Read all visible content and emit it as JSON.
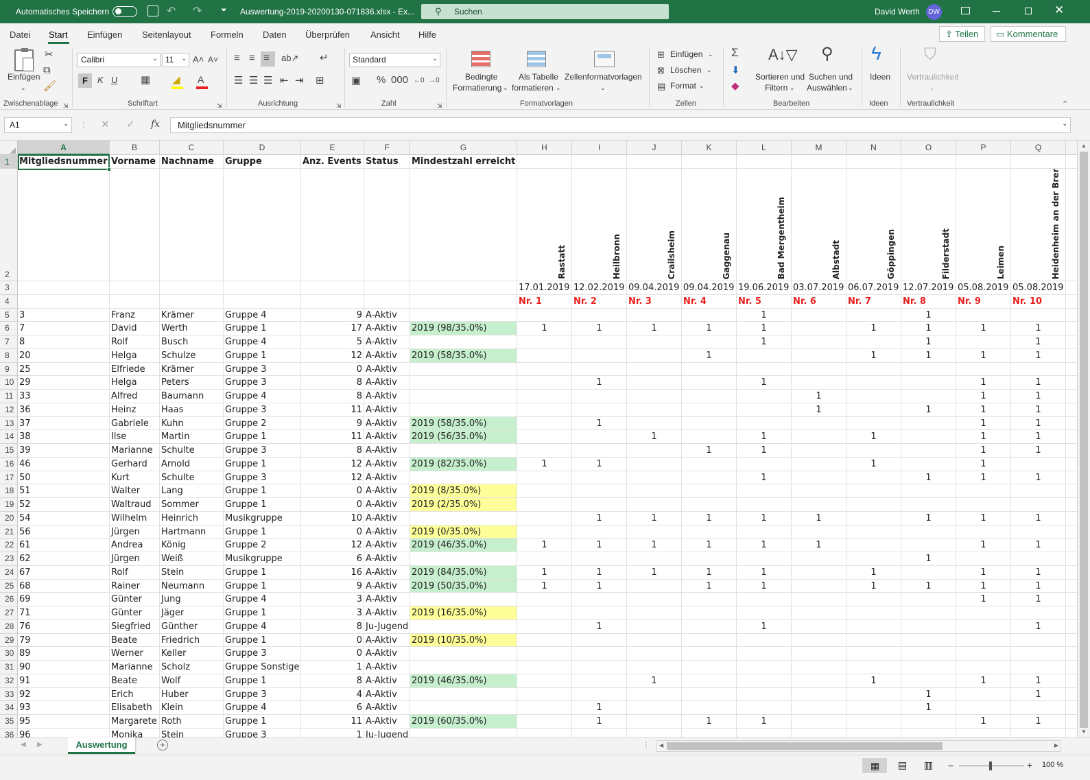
{
  "titlebar": {
    "autosave_label": "Automatisches Speichern",
    "filename": "Auswertung-2019-20200130-071836.xlsx - Ex...",
    "search_placeholder": "Suchen",
    "user_name": "David Werth",
    "user_initials": "DW"
  },
  "tabs": [
    "Datei",
    "Start",
    "Einfügen",
    "Seitenlayout",
    "Formeln",
    "Daten",
    "Überprüfen",
    "Ansicht",
    "Hilfe"
  ],
  "active_tab": "Start",
  "share_label": "Teilen",
  "comments_label": "Kommentare",
  "ribbon": {
    "paste": "Einfügen",
    "font_name": "Calibri",
    "font_size": "11",
    "bold": "F",
    "italic": "K",
    "underline": "U",
    "number_format": "Standard",
    "cond_format_1": "Bedingte",
    "cond_format_2": "Formatierung",
    "as_table_1": "Als Tabelle",
    "as_table_2": "formatieren",
    "cell_styles": "Zellenformatvorlagen",
    "cells_insert": "Einfügen",
    "cells_delete": "Löschen",
    "cells_format": "Format",
    "sort_1": "Sortieren und",
    "sort_2": "Filtern",
    "find_1": "Suchen und",
    "find_2": "Auswählen",
    "ideas": "Ideen",
    "sensitivity": "Vertraulichkeit",
    "groups": {
      "clipboard": "Zwischenablage",
      "font": "Schriftart",
      "alignment": "Ausrichtung",
      "number": "Zahl",
      "styles": "Formatvorlagen",
      "cells": "Zellen",
      "editing": "Bearbeiten",
      "ideas": "Ideen",
      "sensitivity": "Vertraulichkeit"
    }
  },
  "formula_bar": {
    "name_box": "A1",
    "fx": "fx",
    "content": "Mitgliedsnummer"
  },
  "columns": [
    "A",
    "B",
    "C",
    "D",
    "E",
    "F",
    "G",
    "H",
    "I",
    "J",
    "K",
    "L",
    "M",
    "N",
    "O",
    "P",
    "Q"
  ],
  "header_row": [
    "Mitgliedsnummer",
    "Vorname",
    "Nachname",
    "Gruppe",
    "Anz. Events",
    "Status",
    "Mindestzahl erreicht"
  ],
  "event_places": [
    "Rastatt",
    "Heilbronn",
    "Crailsheim",
    "Gaggenau",
    "Bad Mergentheim",
    "Albstadt",
    "Göppingen",
    "Filderstadt",
    "Leimen",
    "Heidenheim an der Brenz"
  ],
  "event_dates": [
    "17.01.2019",
    "12.02.2019",
    "09.04.2019",
    "09.04.2019",
    "19.06.2019",
    "03.07.2019",
    "06.07.2019",
    "12.07.2019",
    "05.08.2019",
    "05.08.2019"
  ],
  "event_numbers": [
    "Nr. 1",
    "Nr. 2",
    "Nr. 3",
    "Nr. 4",
    "Nr. 5",
    "Nr. 6",
    "Nr. 7",
    "Nr. 8",
    "Nr. 9",
    "Nr. 10"
  ],
  "members": [
    {
      "row": "5",
      "nr": "3",
      "first": "Franz",
      "last": "Krämer",
      "group": "Gruppe 4",
      "events": "9",
      "status": "A-Aktiv",
      "min": "",
      "hl": "",
      "e": [
        "",
        "",
        "",
        "",
        "1",
        "",
        "",
        "1",
        "",
        ""
      ]
    },
    {
      "row": "6",
      "nr": "7",
      "first": "David",
      "last": "Werth",
      "group": "Gruppe 1",
      "events": "17",
      "status": "A-Aktiv",
      "min": "2019 (98/35.0%)",
      "hl": "green",
      "e": [
        "1",
        "1",
        "1",
        "1",
        "1",
        "",
        "1",
        "1",
        "1",
        "1"
      ]
    },
    {
      "row": "7",
      "nr": "8",
      "first": "Rolf",
      "last": "Busch",
      "group": "Gruppe 4",
      "events": "5",
      "status": "A-Aktiv",
      "min": "",
      "hl": "",
      "e": [
        "",
        "",
        "",
        "",
        "1",
        "",
        "",
        "1",
        "",
        "1"
      ]
    },
    {
      "row": "8",
      "nr": "20",
      "first": "Helga",
      "last": "Schulze",
      "group": "Gruppe 1",
      "events": "12",
      "status": "A-Aktiv",
      "min": "2019 (58/35.0%)",
      "hl": "green",
      "e": [
        "",
        "",
        "",
        "1",
        "",
        "",
        "1",
        "1",
        "1",
        "1"
      ]
    },
    {
      "row": "9",
      "nr": "25",
      "first": "Elfriede",
      "last": "Krämer",
      "group": "Gruppe 3",
      "events": "0",
      "status": "A-Aktiv",
      "min": "",
      "hl": "",
      "e": [
        "",
        "",
        "",
        "",
        "",
        "",
        "",
        "",
        "",
        ""
      ]
    },
    {
      "row": "10",
      "nr": "29",
      "first": "Helga",
      "last": "Peters",
      "group": "Gruppe 3",
      "events": "8",
      "status": "A-Aktiv",
      "min": "",
      "hl": "",
      "e": [
        "",
        "1",
        "",
        "",
        "1",
        "",
        "",
        "",
        "1",
        "1"
      ]
    },
    {
      "row": "11",
      "nr": "33",
      "first": "Alfred",
      "last": "Baumann",
      "group": "Gruppe 4",
      "events": "8",
      "status": "A-Aktiv",
      "min": "",
      "hl": "",
      "e": [
        "",
        "",
        "",
        "",
        "",
        "1",
        "",
        "",
        "1",
        "1"
      ]
    },
    {
      "row": "12",
      "nr": "36",
      "first": "Heinz",
      "last": "Haas",
      "group": "Gruppe 3",
      "events": "11",
      "status": "A-Aktiv",
      "min": "",
      "hl": "",
      "e": [
        "",
        "",
        "",
        "",
        "",
        "1",
        "",
        "1",
        "1",
        "1"
      ]
    },
    {
      "row": "13",
      "nr": "37",
      "first": "Gabriele",
      "last": "Kuhn",
      "group": "Gruppe 2",
      "events": "9",
      "status": "A-Aktiv",
      "min": "2019 (58/35.0%)",
      "hl": "green",
      "e": [
        "",
        "1",
        "",
        "",
        "",
        "",
        "",
        "",
        "1",
        "1"
      ]
    },
    {
      "row": "14",
      "nr": "38",
      "first": "Ilse",
      "last": "Martin",
      "group": "Gruppe 1",
      "events": "11",
      "status": "A-Aktiv",
      "min": "2019 (56/35.0%)",
      "hl": "green",
      "e": [
        "",
        "",
        "1",
        "",
        "1",
        "",
        "1",
        "",
        "1",
        "1"
      ]
    },
    {
      "row": "15",
      "nr": "39",
      "first": "Marianne",
      "last": "Schulte",
      "group": "Gruppe 3",
      "events": "8",
      "status": "A-Aktiv",
      "min": "",
      "hl": "",
      "e": [
        "",
        "",
        "",
        "1",
        "1",
        "",
        "",
        "",
        "1",
        "1"
      ]
    },
    {
      "row": "16",
      "nr": "46",
      "first": "Gerhard",
      "last": "Arnold",
      "group": "Gruppe 1",
      "events": "12",
      "status": "A-Aktiv",
      "min": "2019 (82/35.0%)",
      "hl": "green",
      "e": [
        "1",
        "1",
        "",
        "",
        "",
        "",
        "1",
        "",
        "1",
        ""
      ]
    },
    {
      "row": "17",
      "nr": "50",
      "first": "Kurt",
      "last": "Schulte",
      "group": "Gruppe 3",
      "events": "12",
      "status": "A-Aktiv",
      "min": "",
      "hl": "",
      "e": [
        "",
        "",
        "",
        "",
        "1",
        "",
        "",
        "1",
        "1",
        "1"
      ]
    },
    {
      "row": "18",
      "nr": "51",
      "first": "Walter",
      "last": "Lang",
      "group": "Gruppe 1",
      "events": "0",
      "status": "A-Aktiv",
      "min": "2019 (8/35.0%)",
      "hl": "yellow",
      "e": [
        "",
        "",
        "",
        "",
        "",
        "",
        "",
        "",
        "",
        ""
      ]
    },
    {
      "row": "19",
      "nr": "52",
      "first": "Waltraud",
      "last": "Sommer",
      "group": "Gruppe 1",
      "events": "0",
      "status": "A-Aktiv",
      "min": "2019 (2/35.0%)",
      "hl": "yellow",
      "e": [
        "",
        "",
        "",
        "",
        "",
        "",
        "",
        "",
        "",
        ""
      ]
    },
    {
      "row": "20",
      "nr": "54",
      "first": "Wilhelm",
      "last": "Heinrich",
      "group": "Musikgruppe",
      "events": "10",
      "status": "A-Aktiv",
      "min": "",
      "hl": "",
      "e": [
        "",
        "1",
        "1",
        "1",
        "1",
        "1",
        "",
        "1",
        "1",
        "1"
      ]
    },
    {
      "row": "21",
      "nr": "56",
      "first": "Jürgen",
      "last": "Hartmann",
      "group": "Gruppe 1",
      "events": "0",
      "status": "A-Aktiv",
      "min": "2019 (0/35.0%)",
      "hl": "yellow",
      "e": [
        "",
        "",
        "",
        "",
        "",
        "",
        "",
        "",
        "",
        ""
      ]
    },
    {
      "row": "22",
      "nr": "61",
      "first": "Andrea",
      "last": "König",
      "group": "Gruppe 2",
      "events": "12",
      "status": "A-Aktiv",
      "min": "2019 (46/35.0%)",
      "hl": "green",
      "e": [
        "1",
        "1",
        "1",
        "1",
        "1",
        "1",
        "",
        "",
        "1",
        "1"
      ]
    },
    {
      "row": "23",
      "nr": "62",
      "first": "Jürgen",
      "last": "Weiß",
      "group": "Musikgruppe",
      "events": "6",
      "status": "A-Aktiv",
      "min": "",
      "hl": "",
      "e": [
        "",
        "",
        "",
        "",
        "",
        "",
        "",
        "1",
        "",
        ""
      ]
    },
    {
      "row": "24",
      "nr": "67",
      "first": "Rolf",
      "last": "Stein",
      "group": "Gruppe 1",
      "events": "16",
      "status": "A-Aktiv",
      "min": "2019 (84/35.0%)",
      "hl": "green",
      "e": [
        "1",
        "1",
        "1",
        "1",
        "1",
        "",
        "1",
        "",
        "1",
        "1"
      ]
    },
    {
      "row": "25",
      "nr": "68",
      "first": "Rainer",
      "last": "Neumann",
      "group": "Gruppe 1",
      "events": "9",
      "status": "A-Aktiv",
      "min": "2019 (50/35.0%)",
      "hl": "green",
      "e": [
        "1",
        "1",
        "",
        "1",
        "1",
        "",
        "1",
        "1",
        "1",
        "1"
      ]
    },
    {
      "row": "26",
      "nr": "69",
      "first": "Günter",
      "last": "Jung",
      "group": "Gruppe 4",
      "events": "3",
      "status": "A-Aktiv",
      "min": "",
      "hl": "",
      "e": [
        "",
        "",
        "",
        "",
        "",
        "",
        "",
        "",
        "1",
        "1"
      ]
    },
    {
      "row": "27",
      "nr": "71",
      "first": "Günter",
      "last": "Jäger",
      "group": "Gruppe 1",
      "events": "3",
      "status": "A-Aktiv",
      "min": "2019 (16/35.0%)",
      "hl": "yellow",
      "e": [
        "",
        "",
        "",
        "",
        "",
        "",
        "",
        "",
        "",
        ""
      ]
    },
    {
      "row": "28",
      "nr": "76",
      "first": "Siegfried",
      "last": "Günther",
      "group": "Gruppe 4",
      "events": "8",
      "status": "Ju-Jugend",
      "min": "",
      "hl": "",
      "e": [
        "",
        "1",
        "",
        "",
        "1",
        "",
        "",
        "",
        "",
        "1"
      ]
    },
    {
      "row": "29",
      "nr": "79",
      "first": "Beate",
      "last": "Friedrich",
      "group": "Gruppe 1",
      "events": "0",
      "status": "A-Aktiv",
      "min": "2019 (10/35.0%)",
      "hl": "yellow",
      "e": [
        "",
        "",
        "",
        "",
        "",
        "",
        "",
        "",
        "",
        ""
      ]
    },
    {
      "row": "30",
      "nr": "89",
      "first": "Werner",
      "last": "Keller",
      "group": "Gruppe 3",
      "events": "0",
      "status": "A-Aktiv",
      "min": "",
      "hl": "",
      "e": [
        "",
        "",
        "",
        "",
        "",
        "",
        "",
        "",
        "",
        ""
      ]
    },
    {
      "row": "31",
      "nr": "90",
      "first": "Marianne",
      "last": "Scholz",
      "group": "Gruppe Sonstige",
      "events": "1",
      "status": "A-Aktiv",
      "min": "",
      "hl": "",
      "e": [
        "",
        "",
        "",
        "",
        "",
        "",
        "",
        "",
        "",
        ""
      ]
    },
    {
      "row": "32",
      "nr": "91",
      "first": "Beate",
      "last": "Wolf",
      "group": "Gruppe 1",
      "events": "8",
      "status": "A-Aktiv",
      "min": "2019 (46/35.0%)",
      "hl": "green",
      "e": [
        "",
        "",
        "1",
        "",
        "",
        "",
        "1",
        "",
        "1",
        "1"
      ]
    },
    {
      "row": "33",
      "nr": "92",
      "first": "Erich",
      "last": "Huber",
      "group": "Gruppe 3",
      "events": "4",
      "status": "A-Aktiv",
      "min": "",
      "hl": "",
      "e": [
        "",
        "",
        "",
        "",
        "",
        "",
        "",
        "1",
        "",
        "1"
      ]
    },
    {
      "row": "34",
      "nr": "93",
      "first": "Elisabeth",
      "last": "Klein",
      "group": "Gruppe 4",
      "events": "6",
      "status": "A-Aktiv",
      "min": "",
      "hl": "",
      "e": [
        "",
        "1",
        "",
        "",
        "",
        "",
        "",
        "1",
        "",
        ""
      ]
    },
    {
      "row": "35",
      "nr": "95",
      "first": "Margarete",
      "last": "Roth",
      "group": "Gruppe 1",
      "events": "11",
      "status": "A-Aktiv",
      "min": "2019 (60/35.0%)",
      "hl": "green",
      "e": [
        "",
        "1",
        "",
        "1",
        "1",
        "",
        "",
        "",
        "1",
        "1"
      ]
    },
    {
      "row": "36",
      "nr": "96",
      "first": "Monika",
      "last": "Stein",
      "group": "Gruppe 3",
      "events": "1",
      "status": "Ju-Jugend",
      "min": "",
      "hl": "",
      "e": [
        "",
        "",
        "",
        "",
        "",
        "",
        "",
        "",
        "",
        ""
      ]
    }
  ],
  "sheet_tab": "Auswertung",
  "zoom": "100 %",
  "colors": {
    "accent": "#217346",
    "highlight_green": "#c6efce",
    "highlight_yellow": "#ffff99",
    "event_number_red": "#e8201e"
  }
}
